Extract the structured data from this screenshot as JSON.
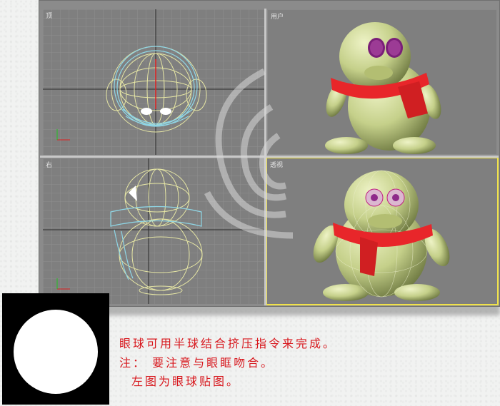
{
  "viewports": {
    "top": {
      "label": "顶"
    },
    "user": {
      "label": "用户"
    },
    "right": {
      "label": "右"
    },
    "persp": {
      "label": "透视"
    }
  },
  "captions": [
    "眼球可用半球结合挤压指令来完成。",
    "注： 要注意与眼眶吻合。",
    "左图为眼球贴图。"
  ],
  "colors": {
    "viewport_bg": "#7f7f7f",
    "body": "#c7d28e",
    "scarf": "#e8262a",
    "eye": "#8e2a8a",
    "wire_yellow": "#e6e6a4",
    "wire_cyan": "#8fd6e6",
    "active_border": "#f0e24a",
    "caption": "#d8181e"
  }
}
